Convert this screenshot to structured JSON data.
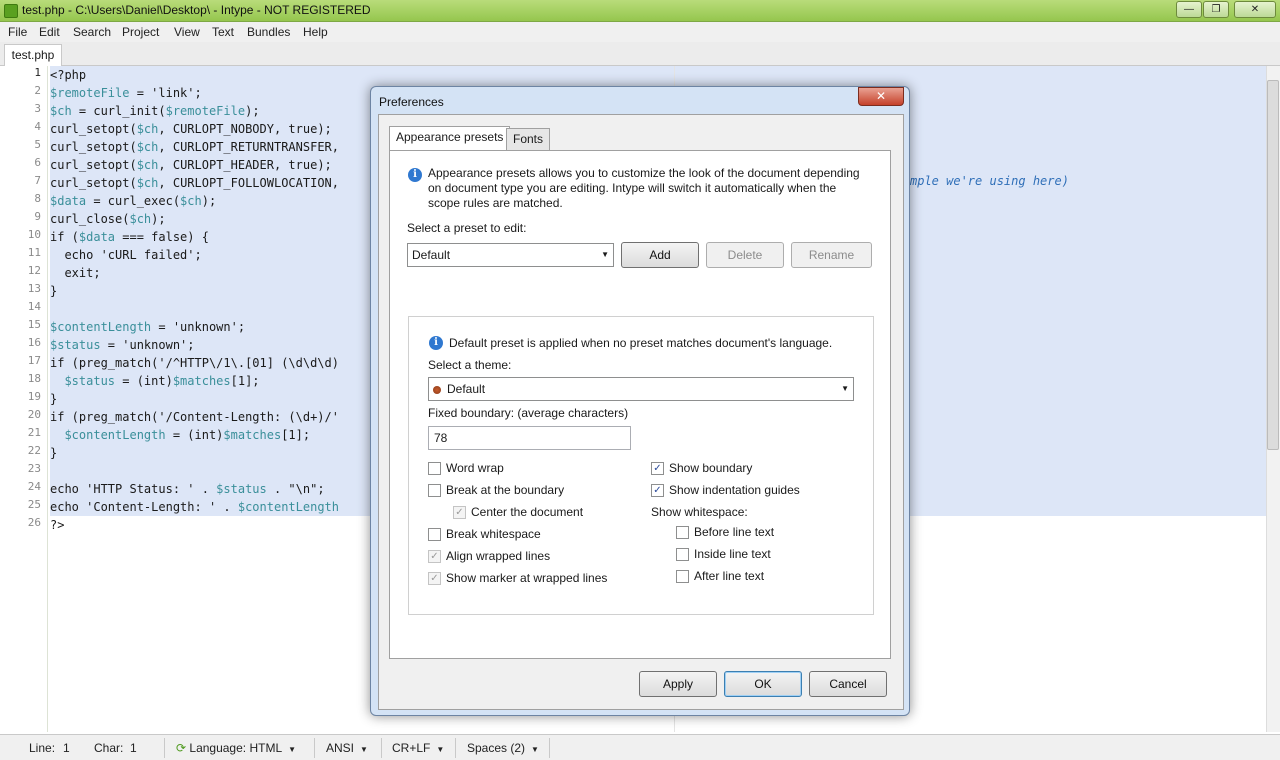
{
  "window": {
    "title": "test.php - C:\\Users\\Daniel\\Desktop\\ - Intype  - NOT REGISTERED",
    "minimize_glyph": "—",
    "maximize_glyph": "❐",
    "close_glyph": "✕"
  },
  "menu": [
    "File",
    "Edit",
    "Search",
    "Project",
    "View",
    "Text",
    "Bundles",
    "Help"
  ],
  "tab": {
    "label": "test.php"
  },
  "editor": {
    "line_numbers": [
      "1",
      "2",
      "3",
      "4",
      "5",
      "6",
      "7",
      "8",
      "9",
      "10",
      "11",
      "12",
      "13",
      "14",
      "15",
      "16",
      "17",
      "18",
      "19",
      "20",
      "21",
      "22",
      "23",
      "24",
      "25",
      "26"
    ],
    "lines": [
      "<?php",
      "$remoteFile = 'link';",
      "$ch = curl_init($remoteFile);",
      "curl_setopt($ch, CURLOPT_NOBODY, true);",
      "curl_setopt($ch, CURLOPT_RETURNTRANSFER,",
      "curl_setopt($ch, CURLOPT_HEADER, true);",
      "curl_setopt($ch, CURLOPT_FOLLOWLOCATION,",
      "$data = curl_exec($ch);",
      "curl_close($ch);",
      "if ($data === false) {",
      "  echo 'cURL failed';",
      "  exit;",
      "}",
      "",
      "$contentLength = 'unknown';",
      "$status = 'unknown';",
      "if (preg_match('/^HTTP\\/1\\.[01] (\\d\\d\\d)",
      "  $status = (int)$matches[1];",
      "}",
      "if (preg_match('/Content-Length: (\\d+)/'",
      "  $contentLength = (int)$matches[1];",
      "}",
      "",
      "echo 'HTTP Status: ' . $status . \"\\n\";",
      "echo 'Content-Length: ' . $contentLength",
      "?>"
    ],
    "comment_fragment": "mple we're using here)"
  },
  "statusbar": {
    "line_label": "Line:",
    "line_value": "1",
    "char_label": "Char:",
    "char_value": "1",
    "language": "Language: HTML",
    "encoding": "ANSI",
    "line_ending": "CR+LF",
    "indent": "Spaces (2)"
  },
  "dialog": {
    "title": "Preferences",
    "tabs": [
      "Appearance presets",
      "Fonts"
    ],
    "info_text": [
      "Appearance presets allows you to customize the look of the document depending",
      "on document type you are editing. Intype will switch it automatically when the",
      "scope rules are matched."
    ],
    "select_preset_label": "Select a preset to edit:",
    "preset_value": "Default",
    "add_label": "Add",
    "delete_label": "Delete",
    "rename_label": "Rename",
    "default_info": "Default preset is applied when no preset matches document's language.",
    "select_theme_label": "Select a theme:",
    "theme_value": "Default",
    "fixed_boundary_label": "Fixed boundary: (average characters)",
    "fixed_boundary_value": "78",
    "checkboxes": {
      "word_wrap": "Word wrap",
      "break_boundary": "Break at the boundary",
      "center_document": "Center the document",
      "break_whitespace": "Break whitespace",
      "align_wrapped": "Align wrapped lines",
      "show_marker": "Show marker at wrapped lines",
      "show_boundary": "Show boundary",
      "show_guides": "Show indentation guides",
      "before_line": "Before line text",
      "inside_line": "Inside line text",
      "after_line": "After line text"
    },
    "show_whitespace_label": "Show whitespace:",
    "check_glyph": "✓",
    "apply_label": "Apply",
    "ok_label": "OK",
    "cancel_label": "Cancel"
  }
}
